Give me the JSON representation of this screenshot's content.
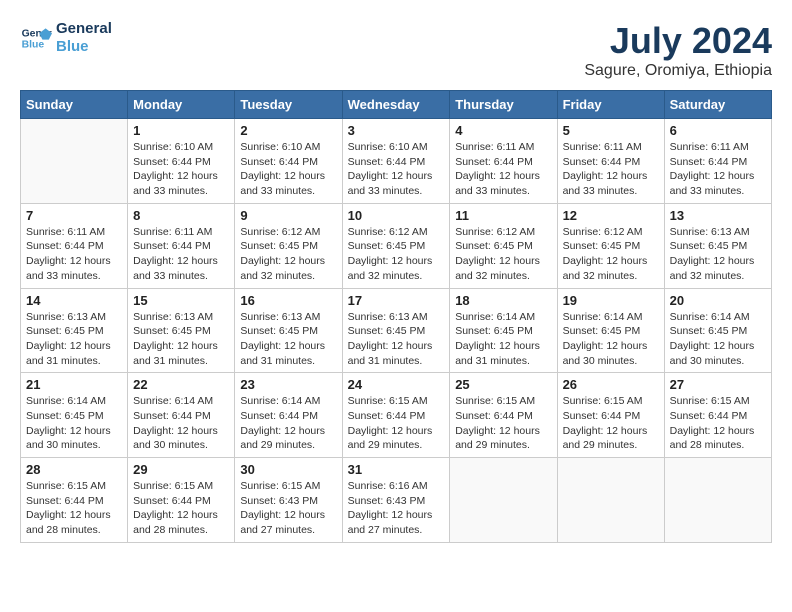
{
  "header": {
    "logo_line1": "General",
    "logo_line2": "Blue",
    "month_title": "July 2024",
    "location": "Sagure, Oromiya, Ethiopia"
  },
  "days_of_week": [
    "Sunday",
    "Monday",
    "Tuesday",
    "Wednesday",
    "Thursday",
    "Friday",
    "Saturday"
  ],
  "weeks": [
    [
      {
        "day": "",
        "sunrise": "",
        "sunset": "",
        "daylight": ""
      },
      {
        "day": "1",
        "sunrise": "6:10 AM",
        "sunset": "6:44 PM",
        "daylight": "12 hours and 33 minutes."
      },
      {
        "day": "2",
        "sunrise": "6:10 AM",
        "sunset": "6:44 PM",
        "daylight": "12 hours and 33 minutes."
      },
      {
        "day": "3",
        "sunrise": "6:10 AM",
        "sunset": "6:44 PM",
        "daylight": "12 hours and 33 minutes."
      },
      {
        "day": "4",
        "sunrise": "6:11 AM",
        "sunset": "6:44 PM",
        "daylight": "12 hours and 33 minutes."
      },
      {
        "day": "5",
        "sunrise": "6:11 AM",
        "sunset": "6:44 PM",
        "daylight": "12 hours and 33 minutes."
      },
      {
        "day": "6",
        "sunrise": "6:11 AM",
        "sunset": "6:44 PM",
        "daylight": "12 hours and 33 minutes."
      }
    ],
    [
      {
        "day": "7",
        "sunrise": "6:11 AM",
        "sunset": "6:44 PM",
        "daylight": "12 hours and 33 minutes."
      },
      {
        "day": "8",
        "sunrise": "6:11 AM",
        "sunset": "6:44 PM",
        "daylight": "12 hours and 33 minutes."
      },
      {
        "day": "9",
        "sunrise": "6:12 AM",
        "sunset": "6:45 PM",
        "daylight": "12 hours and 32 minutes."
      },
      {
        "day": "10",
        "sunrise": "6:12 AM",
        "sunset": "6:45 PM",
        "daylight": "12 hours and 32 minutes."
      },
      {
        "day": "11",
        "sunrise": "6:12 AM",
        "sunset": "6:45 PM",
        "daylight": "12 hours and 32 minutes."
      },
      {
        "day": "12",
        "sunrise": "6:12 AM",
        "sunset": "6:45 PM",
        "daylight": "12 hours and 32 minutes."
      },
      {
        "day": "13",
        "sunrise": "6:13 AM",
        "sunset": "6:45 PM",
        "daylight": "12 hours and 32 minutes."
      }
    ],
    [
      {
        "day": "14",
        "sunrise": "6:13 AM",
        "sunset": "6:45 PM",
        "daylight": "12 hours and 31 minutes."
      },
      {
        "day": "15",
        "sunrise": "6:13 AM",
        "sunset": "6:45 PM",
        "daylight": "12 hours and 31 minutes."
      },
      {
        "day": "16",
        "sunrise": "6:13 AM",
        "sunset": "6:45 PM",
        "daylight": "12 hours and 31 minutes."
      },
      {
        "day": "17",
        "sunrise": "6:13 AM",
        "sunset": "6:45 PM",
        "daylight": "12 hours and 31 minutes."
      },
      {
        "day": "18",
        "sunrise": "6:14 AM",
        "sunset": "6:45 PM",
        "daylight": "12 hours and 31 minutes."
      },
      {
        "day": "19",
        "sunrise": "6:14 AM",
        "sunset": "6:45 PM",
        "daylight": "12 hours and 30 minutes."
      },
      {
        "day": "20",
        "sunrise": "6:14 AM",
        "sunset": "6:45 PM",
        "daylight": "12 hours and 30 minutes."
      }
    ],
    [
      {
        "day": "21",
        "sunrise": "6:14 AM",
        "sunset": "6:45 PM",
        "daylight": "12 hours and 30 minutes."
      },
      {
        "day": "22",
        "sunrise": "6:14 AM",
        "sunset": "6:44 PM",
        "daylight": "12 hours and 30 minutes."
      },
      {
        "day": "23",
        "sunrise": "6:14 AM",
        "sunset": "6:44 PM",
        "daylight": "12 hours and 29 minutes."
      },
      {
        "day": "24",
        "sunrise": "6:15 AM",
        "sunset": "6:44 PM",
        "daylight": "12 hours and 29 minutes."
      },
      {
        "day": "25",
        "sunrise": "6:15 AM",
        "sunset": "6:44 PM",
        "daylight": "12 hours and 29 minutes."
      },
      {
        "day": "26",
        "sunrise": "6:15 AM",
        "sunset": "6:44 PM",
        "daylight": "12 hours and 29 minutes."
      },
      {
        "day": "27",
        "sunrise": "6:15 AM",
        "sunset": "6:44 PM",
        "daylight": "12 hours and 28 minutes."
      }
    ],
    [
      {
        "day": "28",
        "sunrise": "6:15 AM",
        "sunset": "6:44 PM",
        "daylight": "12 hours and 28 minutes."
      },
      {
        "day": "29",
        "sunrise": "6:15 AM",
        "sunset": "6:44 PM",
        "daylight": "12 hours and 28 minutes."
      },
      {
        "day": "30",
        "sunrise": "6:15 AM",
        "sunset": "6:43 PM",
        "daylight": "12 hours and 27 minutes."
      },
      {
        "day": "31",
        "sunrise": "6:16 AM",
        "sunset": "6:43 PM",
        "daylight": "12 hours and 27 minutes."
      },
      {
        "day": "",
        "sunrise": "",
        "sunset": "",
        "daylight": ""
      },
      {
        "day": "",
        "sunrise": "",
        "sunset": "",
        "daylight": ""
      },
      {
        "day": "",
        "sunrise": "",
        "sunset": "",
        "daylight": ""
      }
    ]
  ]
}
